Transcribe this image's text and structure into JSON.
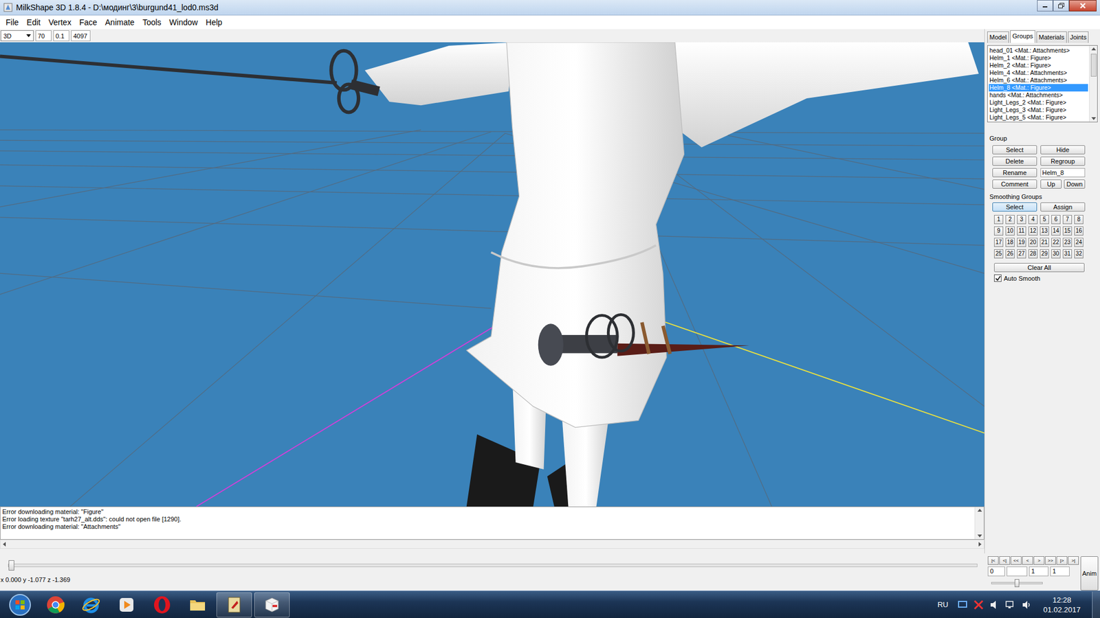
{
  "window": {
    "title": "MilkShape 3D 1.8.4 - D:\\модинг\\3\\burgund41_lod0.ms3d"
  },
  "menu": [
    "File",
    "Edit",
    "Vertex",
    "Face",
    "Animate",
    "Tools",
    "Window",
    "Help"
  ],
  "toolbar": {
    "view": "3D",
    "fields": [
      "70",
      "0.1",
      "4097"
    ]
  },
  "panel_tabs": [
    {
      "label": "Model",
      "selected": false
    },
    {
      "label": "Groups",
      "selected": true
    },
    {
      "label": "Materials",
      "selected": false
    },
    {
      "label": "Joints",
      "selected": false
    }
  ],
  "groups": [
    {
      "label": "head_01  <Mat.: Attachments>",
      "selected": false
    },
    {
      "label": "Helm_1 <Mat.: Figure>",
      "selected": false
    },
    {
      "label": "Helm_2 <Mat.: Figure>",
      "selected": false
    },
    {
      "label": "Helm_4 <Mat.: Attachments>",
      "selected": false
    },
    {
      "label": "Helm_6 <Mat.: Attachments>",
      "selected": false
    },
    {
      "label": "Helm_8 <Mat.: Figure>",
      "selected": true
    },
    {
      "label": "hands <Mat.: Attachments>",
      "selected": false
    },
    {
      "label": "Light_Legs_2  <Mat.: Figure>",
      "selected": false
    },
    {
      "label": "Light_Legs_3 <Mat.: Figure>",
      "selected": false
    },
    {
      "label": "Light_Legs_5 <Mat.: Figure>",
      "selected": false
    }
  ],
  "group": {
    "title": "Group",
    "select": "Select",
    "hide": "Hide",
    "delete": "Delete",
    "regroup": "Regroup",
    "rename": "Rename",
    "name_value": "Helm_8",
    "comment": "Comment",
    "up": "Up",
    "down": "Down"
  },
  "smoothing": {
    "title": "Smoothing Groups",
    "select": {
      "label": "Select",
      "selected": true
    },
    "assign": "Assign",
    "numbers": [
      "1",
      "2",
      "3",
      "4",
      "5",
      "6",
      "7",
      "8",
      "9",
      "10",
      "11",
      "12",
      "13",
      "14",
      "15",
      "16",
      "17",
      "18",
      "19",
      "20",
      "21",
      "22",
      "23",
      "24",
      "25",
      "26",
      "27",
      "28",
      "29",
      "30",
      "31",
      "32"
    ],
    "clear_all": "Clear All",
    "auto_smooth": {
      "label": "Auto Smooth",
      "checked": true
    }
  },
  "messages": [
    "Error downloading material: \"Figure\"",
    "Error loading texture \"tarh27_alt.dds\": could not open file [1290].",
    "Error downloading material: \"Attachments\""
  ],
  "animation": {
    "level": 0,
    "buttons": [
      "|<",
      "<|",
      "<<",
      "<",
      ">",
      ">>",
      "|>",
      ">|"
    ],
    "start": "0",
    "current": "1",
    "total": "1",
    "anim_button": "Anim",
    "speed_level": 0.5
  },
  "status_bar": {
    "coords": "x 0.000 y -1.077 z -1.369"
  },
  "taskbar": {
    "language": "RU",
    "time": "12:28",
    "date": "01.02.2017"
  }
}
